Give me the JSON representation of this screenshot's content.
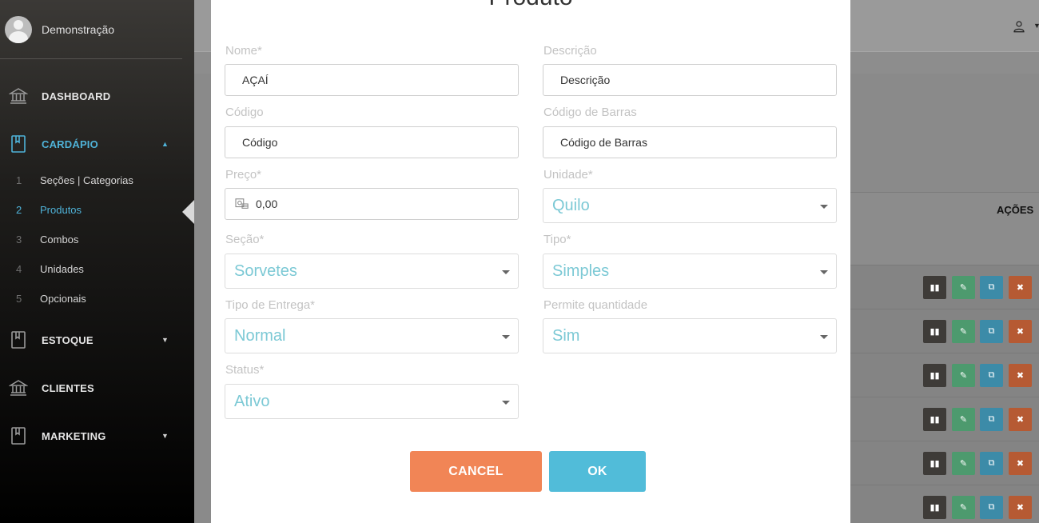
{
  "sidebar": {
    "user_name": "Demonstração",
    "items": [
      {
        "label": "DASHBOARD"
      },
      {
        "label": "CARDÁPIO",
        "caret": "▲"
      },
      {
        "label": "ESTOQUE",
        "caret": "▼"
      },
      {
        "label": "CLIENTES"
      },
      {
        "label": "MARKETING",
        "caret": "▼"
      }
    ],
    "subitems": [
      {
        "num": "1",
        "label": "Seções | Categorias"
      },
      {
        "num": "2",
        "label": "Produtos"
      },
      {
        "num": "3",
        "label": "Combos"
      },
      {
        "num": "4",
        "label": "Unidades"
      },
      {
        "num": "5",
        "label": "Opcionais"
      }
    ],
    "accent_color": "#4fb3d9"
  },
  "background": {
    "table_header_actions": "AÇÕES",
    "user_caret": "▼",
    "row_action_icons": [
      "pause-icon",
      "edit-icon",
      "copy-icon",
      "delete-icon"
    ],
    "row_action_glyphs": {
      "pause": "▮▮",
      "edit": "✎",
      "copy": "⧉",
      "delete": "✖"
    },
    "row_count": 6
  },
  "modal": {
    "title": "Produto",
    "fields": {
      "nome": {
        "label": "Nome*",
        "value": "AÇAÍ"
      },
      "descricao": {
        "label": "Descrição",
        "placeholder": "Descrição"
      },
      "codigo": {
        "label": "Código",
        "placeholder": "Código"
      },
      "codigo_barras": {
        "label": "Código de Barras",
        "placeholder": "Código de Barras"
      },
      "preco": {
        "label": "Preço*",
        "value": "0,00"
      },
      "unidade": {
        "label": "Unidade*",
        "selected": "Quilo"
      },
      "secao": {
        "label": "Seção*",
        "selected": "Sorvetes"
      },
      "tipo": {
        "label": "Tipo*",
        "selected": "Simples"
      },
      "tipo_entrega": {
        "label": "Tipo de Entrega*",
        "selected": "Normal"
      },
      "permite_quantidade": {
        "label": "Permite quantidade",
        "selected": "Sim"
      },
      "status": {
        "label": "Status*",
        "selected": "Ativo"
      }
    },
    "buttons": {
      "cancel": "CANCEL",
      "ok": "OK"
    },
    "colors": {
      "cancel": "#f18556",
      "ok": "#51bcd9",
      "select_text": "#7cc9d5"
    }
  }
}
